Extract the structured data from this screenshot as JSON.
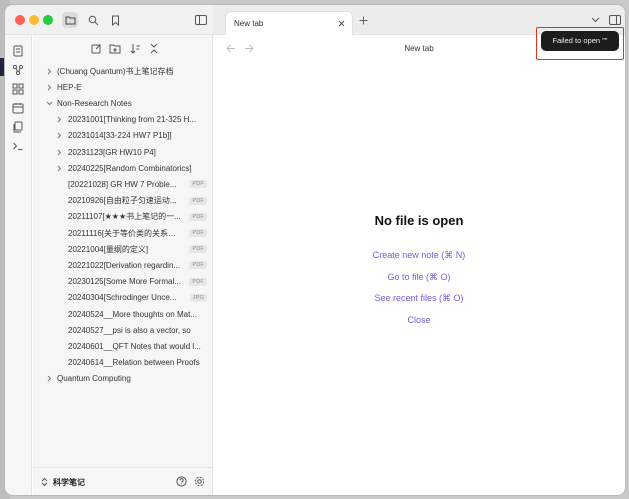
{
  "colors": {
    "accent": "#7b5cd6",
    "annotation": "#e0331f",
    "notice_bg": "#1c1c1c"
  },
  "icons": {
    "traffic_lights": [
      "close",
      "minimize",
      "zoom"
    ],
    "top_left": [
      "folder-icon",
      "search-icon",
      "bookmark-icon",
      "sidebar-toggle-icon"
    ],
    "ribbon": [
      "file-switcher-icon",
      "graph-icon",
      "canvas-icon",
      "calendar-icon",
      "templates-icon",
      "terminal-icon"
    ],
    "file_nav": [
      "new-note-icon",
      "new-folder-icon",
      "sort-icon",
      "collapse-all-icon"
    ]
  },
  "tab": {
    "label": "New tab"
  },
  "header": {
    "title": "New tab"
  },
  "notice": {
    "text": "Failed to open \"\""
  },
  "empty_state": {
    "title": "No file is open",
    "actions": [
      {
        "label": "Create new note (⌘ N)"
      },
      {
        "label": "Go to file (⌘ O)"
      },
      {
        "label": "See recent files (⌘ O)"
      },
      {
        "label": "Close"
      }
    ]
  },
  "tree": [
    {
      "label": "(Chuang Quantum)书上笔记存档",
      "type": "folder",
      "expanded": false,
      "depth": 0
    },
    {
      "label": "HEP-E",
      "type": "folder",
      "expanded": false,
      "depth": 0
    },
    {
      "label": "Non-Research Notes",
      "type": "folder",
      "expanded": true,
      "depth": 0
    },
    {
      "label": "20231001[Thinking from 21-325 H...",
      "type": "folder",
      "expanded": false,
      "depth": 1
    },
    {
      "label": "20231014[33-224 HW7 P1b]]",
      "type": "folder",
      "expanded": false,
      "depth": 1
    },
    {
      "label": "20231123[GR HW10 P4]",
      "type": "folder",
      "expanded": false,
      "depth": 1
    },
    {
      "label": "20240225[Random Combinatorics]",
      "type": "folder",
      "expanded": false,
      "depth": 1
    },
    {
      "label": "[20221028] GR HW 7 Proble...",
      "type": "file",
      "badge": "PDF",
      "depth": 1
    },
    {
      "label": "20210926[自由粒子匀速运动...",
      "type": "file",
      "badge": "PDF",
      "depth": 1
    },
    {
      "label": "20211107[★★★书上笔记的一...",
      "type": "file",
      "badge": "PDF",
      "depth": 1
    },
    {
      "label": "20211116[关于等价类的关系以...",
      "type": "file",
      "badge": "PDF",
      "depth": 1
    },
    {
      "label": "20221004[量纲的定义]",
      "type": "file",
      "badge": "PDF",
      "depth": 1
    },
    {
      "label": "20221022[Derivation regardin...",
      "type": "file",
      "badge": "PDF",
      "depth": 1
    },
    {
      "label": "20230125[Some More Formal...",
      "type": "file",
      "badge": "PDF",
      "depth": 1
    },
    {
      "label": "20240304[Schrodinger Unce...",
      "type": "file",
      "badge": "JPG",
      "depth": 1
    },
    {
      "label": "20240524__More thoughts on Mat...",
      "type": "file",
      "depth": 1
    },
    {
      "label": "20240527__psi is also a vector, so",
      "type": "file",
      "depth": 1
    },
    {
      "label": "20240601__QFT Notes that would l...",
      "type": "file",
      "depth": 1
    },
    {
      "label": "20240614__Relation between Proofs",
      "type": "file",
      "depth": 1
    },
    {
      "label": "Quantum Computing",
      "type": "folder",
      "expanded": false,
      "depth": 0
    }
  ],
  "vault": {
    "name": "科学笔记"
  }
}
